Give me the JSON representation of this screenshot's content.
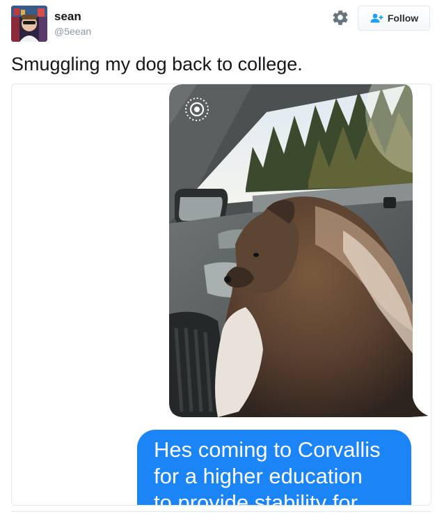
{
  "tweet": {
    "user": {
      "display_name": "sean",
      "handle": "@5eean"
    },
    "text": "Smuggling my dog back to college.",
    "actions": {
      "follow_label": "Follow",
      "settings_icon": "gear-icon",
      "follow_icon": "add-person-icon"
    }
  },
  "media": {
    "photo_icon": "live-photo-icon",
    "bubble_lines": [
      "Hes coming to Corvallis",
      "for a higher education",
      "to provide stability for"
    ]
  },
  "colors": {
    "accent": "#1da1f2",
    "imessage_blue": "#1b84f6",
    "handle_gray": "#8899a6",
    "border": "#e1e8ed"
  }
}
